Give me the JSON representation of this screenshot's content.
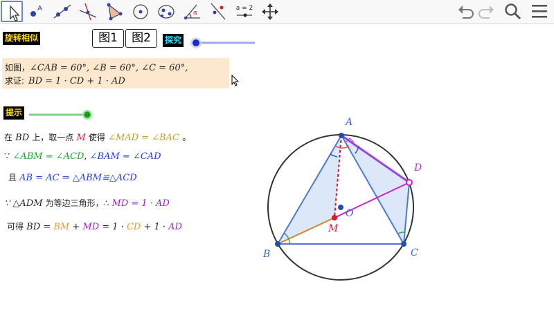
{
  "toolbar": {
    "tools": [
      "move-tool",
      "point-tool",
      "line-tool",
      "perpendicular-line-tool",
      "polygon-tool",
      "circle-center-point-tool",
      "conic-tool",
      "angle-tool",
      "reflect-tool",
      "slider-tool",
      "move-graphics-view-tool"
    ],
    "slider_tool_label": "a = 2",
    "right": [
      "undo",
      "redo",
      "search",
      "menu"
    ]
  },
  "header": {
    "app_title": "旋转相似",
    "fig1_label": "图1",
    "fig2_label": "图2",
    "explore_label": "探究",
    "explore_slider_value": 0
  },
  "problem": {
    "line1_prefix": "如图，",
    "line1_math": "∠CAB = 60°, ∠B = 60°, ∠C = 60°,",
    "line2_prefix": "求证:",
    "line2_math": "BD = 1 · CD + 1 · AD"
  },
  "hint": {
    "label": "提示",
    "slider_value": 1
  },
  "steps": {
    "s1_a": "在",
    "s1_b": "BD",
    "s1_c": "上，取一点",
    "s1_d": "M",
    "s1_e": "使得",
    "s1_f": "∠MAD = ∠BAC",
    "s1_g": "。",
    "s2_sym": "∵",
    "s2_a": "∠ABM = ∠ACD",
    "s2_b": ",",
    "s2_c": "∠BAM = ∠CAD",
    "s3_a": "且",
    "s3_b": "AB = AC",
    "s3_c": "⇒ △ABM≌△ACD",
    "s4_a": "∵ △ADM",
    "s4_b": "为等边三角形，∴",
    "s4_c": "MD =",
    "s4_d": "1 · AD",
    "s5_a": "可得",
    "s5_b": "BD =",
    "s5_c": "BM",
    "s5_d": "+",
    "s5_e": "MD",
    "s5_f": "= 1 ·",
    "s5_g": "CD",
    "s5_h": "+ 1 ·",
    "s5_i": "AD"
  },
  "figure": {
    "points": {
      "A": "A",
      "B": "B",
      "C": "C",
      "D": "D",
      "M": "M",
      "O": "O"
    }
  },
  "colors": {
    "triangle": "#4a79d6",
    "fill": "#d6e4f6",
    "orange": "#e07d2a",
    "magenta": "#d01fd0",
    "red_point": "#e0142e",
    "angle_green": "#3aa24a",
    "angle_red": "#e05050",
    "purple": "#a040e0"
  }
}
